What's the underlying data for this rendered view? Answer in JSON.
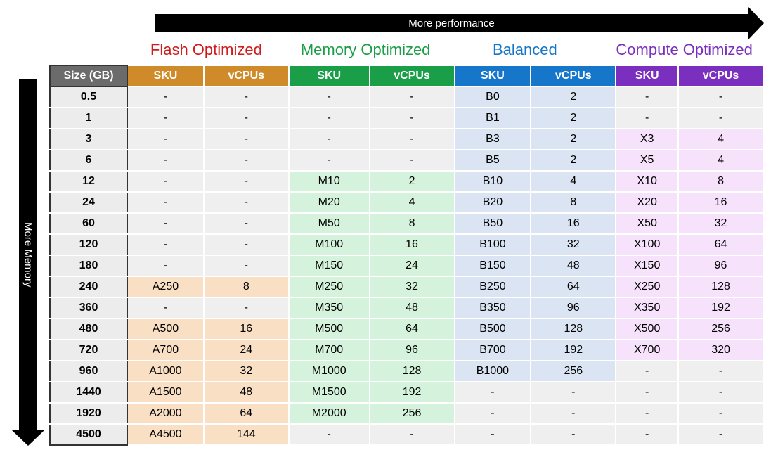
{
  "axis_top": "More performance",
  "axis_left": "More Memory",
  "size_header": "Size (GB)",
  "sub_headers": [
    "SKU",
    "vCPUs"
  ],
  "tiers": [
    {
      "name": "Flash Optimized",
      "class": "flash"
    },
    {
      "name": "Memory Optimized",
      "class": "memory"
    },
    {
      "name": "Balanced",
      "class": "balanced"
    },
    {
      "name": "Compute Optimized",
      "class": "compute"
    }
  ],
  "rows": [
    {
      "size": "0.5",
      "flash": [
        "-",
        "-"
      ],
      "memory": [
        "-",
        "-"
      ],
      "balanced": [
        "B0",
        "2"
      ],
      "compute": [
        "-",
        "-"
      ]
    },
    {
      "size": "1",
      "flash": [
        "-",
        "-"
      ],
      "memory": [
        "-",
        "-"
      ],
      "balanced": [
        "B1",
        "2"
      ],
      "compute": [
        "-",
        "-"
      ]
    },
    {
      "size": "3",
      "flash": [
        "-",
        "-"
      ],
      "memory": [
        "-",
        "-"
      ],
      "balanced": [
        "B3",
        "2"
      ],
      "compute": [
        "X3",
        "4"
      ]
    },
    {
      "size": "6",
      "flash": [
        "-",
        "-"
      ],
      "memory": [
        "-",
        "-"
      ],
      "balanced": [
        "B5",
        "2"
      ],
      "compute": [
        "X5",
        "4"
      ]
    },
    {
      "size": "12",
      "flash": [
        "-",
        "-"
      ],
      "memory": [
        "M10",
        "2"
      ],
      "balanced": [
        "B10",
        "4"
      ],
      "compute": [
        "X10",
        "8"
      ]
    },
    {
      "size": "24",
      "flash": [
        "-",
        "-"
      ],
      "memory": [
        "M20",
        "4"
      ],
      "balanced": [
        "B20",
        "8"
      ],
      "compute": [
        "X20",
        "16"
      ]
    },
    {
      "size": "60",
      "flash": [
        "-",
        "-"
      ],
      "memory": [
        "M50",
        "8"
      ],
      "balanced": [
        "B50",
        "16"
      ],
      "compute": [
        "X50",
        "32"
      ]
    },
    {
      "size": "120",
      "flash": [
        "-",
        "-"
      ],
      "memory": [
        "M100",
        "16"
      ],
      "balanced": [
        "B100",
        "32"
      ],
      "compute": [
        "X100",
        "64"
      ]
    },
    {
      "size": "180",
      "flash": [
        "-",
        "-"
      ],
      "memory": [
        "M150",
        "24"
      ],
      "balanced": [
        "B150",
        "48"
      ],
      "compute": [
        "X150",
        "96"
      ]
    },
    {
      "size": "240",
      "flash": [
        "A250",
        "8"
      ],
      "memory": [
        "M250",
        "32"
      ],
      "balanced": [
        "B250",
        "64"
      ],
      "compute": [
        "X250",
        "128"
      ]
    },
    {
      "size": "360",
      "flash": [
        "-",
        "-"
      ],
      "memory": [
        "M350",
        "48"
      ],
      "balanced": [
        "B350",
        "96"
      ],
      "compute": [
        "X350",
        "192"
      ]
    },
    {
      "size": "480",
      "flash": [
        "A500",
        "16"
      ],
      "memory": [
        "M500",
        "64"
      ],
      "balanced": [
        "B500",
        "128"
      ],
      "compute": [
        "X500",
        "256"
      ]
    },
    {
      "size": "720",
      "flash": [
        "A700",
        "24"
      ],
      "memory": [
        "M700",
        "96"
      ],
      "balanced": [
        "B700",
        "192"
      ],
      "compute": [
        "X700",
        "320"
      ]
    },
    {
      "size": "960",
      "flash": [
        "A1000",
        "32"
      ],
      "memory": [
        "M1000",
        "128"
      ],
      "balanced": [
        "B1000",
        "256"
      ],
      "compute": [
        "-",
        "-"
      ]
    },
    {
      "size": "1440",
      "flash": [
        "A1500",
        "48"
      ],
      "memory": [
        "M1500",
        "192"
      ],
      "balanced": [
        "-",
        "-"
      ],
      "compute": [
        "-",
        "-"
      ]
    },
    {
      "size": "1920",
      "flash": [
        "A2000",
        "64"
      ],
      "memory": [
        "M2000",
        "256"
      ],
      "balanced": [
        "-",
        "-"
      ],
      "compute": [
        "-",
        "-"
      ]
    },
    {
      "size": "4500",
      "flash": [
        "A4500",
        "144"
      ],
      "memory": [
        "-",
        "-"
      ],
      "balanced": [
        "-",
        "-"
      ],
      "compute": [
        "-",
        "-"
      ]
    }
  ]
}
